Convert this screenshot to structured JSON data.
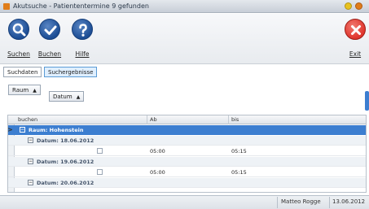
{
  "window": {
    "title": "Akutsuche - Patiententermine 9 gefunden"
  },
  "toolbar": {
    "suchen_label": "Suchen",
    "buchen_label": "Buchen",
    "hilfe_label": "Hilfe",
    "exit_label": "Exit"
  },
  "tabs": [
    {
      "label": "Suchdaten"
    },
    {
      "label": "Suchergebnisse"
    }
  ],
  "grouping": [
    {
      "label": "Raum",
      "sort": "▲"
    },
    {
      "label": "Datum",
      "sort": "▲"
    }
  ],
  "grid": {
    "columns": [
      "buchen",
      "Ab",
      "bis"
    ],
    "group_row": {
      "expander": "−",
      "label": "Raum: Hohenstein"
    },
    "subgroups": [
      {
        "expander": "−",
        "label": "Datum: 18.06.2012",
        "rows": [
          {
            "ab": "05:00",
            "bis": "05:15"
          }
        ]
      },
      {
        "expander": "−",
        "label": "Datum: 19.06.2012",
        "rows": [
          {
            "ab": "05:00",
            "bis": "05:15"
          }
        ]
      },
      {
        "expander": "−",
        "label": "Datum: 20.06.2012"
      }
    ],
    "row_indicator": ">"
  },
  "status": {
    "user": "Matteo Rogge",
    "date": "13.06.2012"
  },
  "colors": {
    "accent": "#3c7ed0",
    "toolbar_icon": "#1c4d94",
    "exit_red": "#e0342c",
    "win_yellow": "#e8c21f",
    "win_orange": "#e07d1a"
  }
}
